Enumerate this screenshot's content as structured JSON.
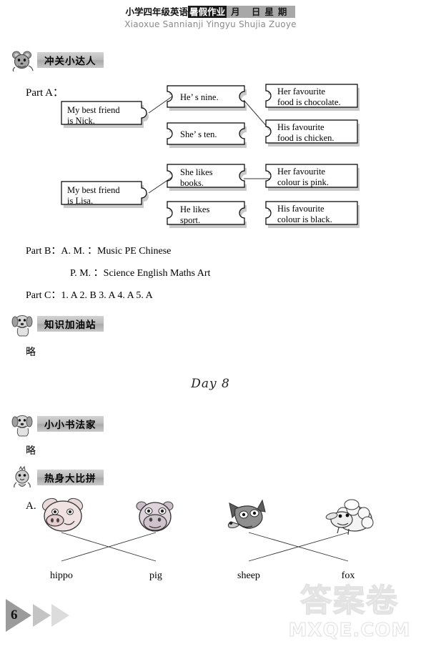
{
  "header": {
    "title_cn": "小学四年级英语",
    "title_highlight": "暑假作业",
    "date_blank": "月  日星期",
    "pinyin": "Xiaoxue Sannianji Yingyu Shujia Zuoye"
  },
  "sections": [
    {
      "id": "chuangguan",
      "icon": "mouse-icon",
      "label": "冲关小达人"
    },
    {
      "id": "zhishi",
      "icon": "dog-icon",
      "label": "知识加油站"
    },
    {
      "id": "shufa",
      "icon": "dog-icon",
      "label": "小小书法家"
    },
    {
      "id": "reshen",
      "icon": "chick-icon",
      "label": "热身大比拼"
    }
  ],
  "part_a": {
    "label": "Part A：",
    "left_pieces": [
      {
        "text": "My  best  friend\nis Nick."
      },
      {
        "text": "My best friend\nis Lisa."
      }
    ],
    "middle_pieces": [
      {
        "text": "He’ s nine."
      },
      {
        "text": "She’ s ten."
      },
      {
        "text": "She likes\nbooks."
      },
      {
        "text": "He likes\nsport."
      }
    ],
    "right_pieces": [
      {
        "text": "Her favourite\nfood is chocolate."
      },
      {
        "text": "His favourite\nfood is chicken."
      },
      {
        "text": "Her favourite\ncolour is pink."
      },
      {
        "text": "His favourite\ncolour is black."
      }
    ]
  },
  "part_b": {
    "line1": "Part B：A. M. ：Music    PE    Chinese",
    "line2": "P. M. ：Science    English    Maths    Art"
  },
  "part_c": {
    "line": "Part C：1. A    2. B    3. A    4. A    5. A"
  },
  "answers": {
    "zhishi_answer": "略",
    "shufa_answer": "略"
  },
  "day_title": "Day 8",
  "warmup": {
    "item_label": "A.",
    "animals": [
      {
        "icon": "pig-head-icon",
        "label": "hippo"
      },
      {
        "icon": "hippo-head-icon",
        "label": "pig"
      },
      {
        "icon": "fox-head-icon",
        "label": "sheep"
      },
      {
        "icon": "sheep-icon",
        "label": "fox"
      }
    ]
  },
  "footer": {
    "page_number": "6",
    "watermark_cn": "答案卷",
    "watermark_en": "MXQE.COM"
  },
  "colors": {
    "banner_gray": "#bdbdbd",
    "header_black": "#1a1a1a",
    "header_gray": "#a8a8a8",
    "page_arrow": "#9b9b9b"
  }
}
